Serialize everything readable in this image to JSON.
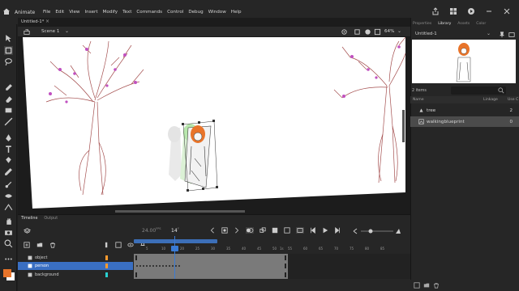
{
  "app": {
    "name": "Animate"
  },
  "menu": [
    "File",
    "Edit",
    "View",
    "Insert",
    "Modify",
    "Text",
    "Commands",
    "Control",
    "Debug",
    "Window",
    "Help"
  ],
  "document": {
    "tab_title": "Untitled-1*",
    "scene": "Scene 1",
    "zoom": "64%"
  },
  "right_panel": {
    "tabs": [
      "Properties",
      "Library",
      "Assets",
      "Color"
    ],
    "active_tab": "Library",
    "library_file": "Untitled-1",
    "item_count": "2 items",
    "columns": {
      "name": "Name",
      "linkage": "Linkage",
      "use_count": "Use C"
    },
    "items": [
      {
        "name": "tree",
        "icon": "symbol-icon",
        "use": "2"
      },
      {
        "name": "walkingblueprint",
        "icon": "graphic-icon",
        "use": "0"
      }
    ]
  },
  "timeline": {
    "tabs": [
      "Timeline",
      "Output"
    ],
    "active_tab": "Timeline",
    "fps": "24.00",
    "fps_unit": "FPS",
    "current_frame": "14",
    "frame_unit": "F",
    "layers": [
      {
        "name": "object",
        "color": "#ff9a2e",
        "selected": false
      },
      {
        "name": "person",
        "color": "#ff9a2e",
        "selected": true
      },
      {
        "name": "background",
        "color": "#2ad0d0",
        "selected": false
      }
    ],
    "ruler": [
      "1s",
      "5",
      "10",
      "15",
      "20",
      "25",
      "30",
      "35",
      "40",
      "45",
      "50",
      "55",
      "60",
      "65",
      "70",
      "75",
      "80",
      "85"
    ]
  },
  "colors": {
    "accent": "#3a6fc2",
    "stage": "#ffffff",
    "onion_green": "#7fd46b",
    "figure_orange": "#e8742a"
  }
}
